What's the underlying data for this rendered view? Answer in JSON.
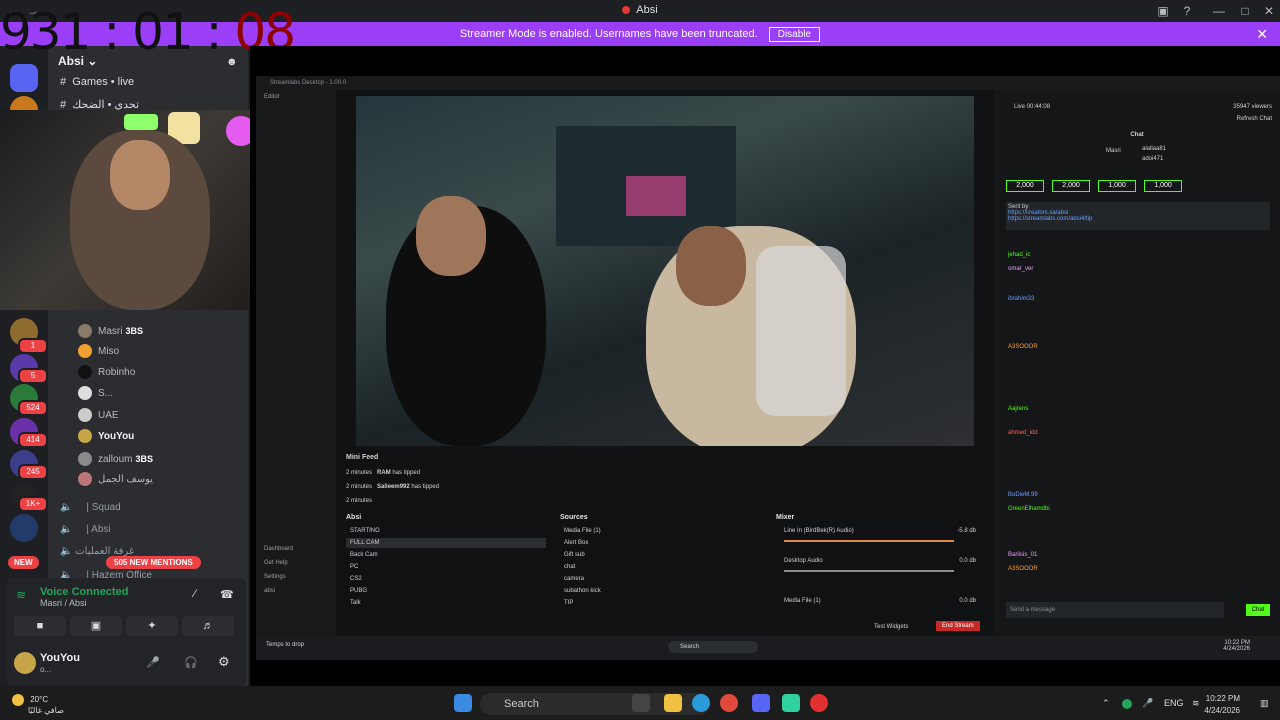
{
  "window": {
    "title": "Absi"
  },
  "banner": {
    "text": "Streamer Mode is enabled. Usernames have been truncated.",
    "button": "Disable"
  },
  "timer": {
    "hours": "931",
    "sep1": ":",
    "minutes": "01",
    "sep2": ":",
    "seconds": "08"
  },
  "rail": {
    "badges": [
      "1",
      "5",
      "524",
      "414",
      "245",
      "1K+"
    ],
    "new_label": "NEW"
  },
  "guild": {
    "name": "Absi"
  },
  "channels": [
    {
      "label": "Games • live"
    },
    {
      "label": "تحدي • الضحك"
    }
  ],
  "members": [
    {
      "name": "Masri",
      "tag": "3BS"
    },
    {
      "name": "Miso",
      "tag": ""
    },
    {
      "name": "Robinho",
      "tag": ""
    },
    {
      "name": "S...",
      "tag": ""
    },
    {
      "name": "UAE",
      "tag": ""
    },
    {
      "name": "YouYou",
      "tag": ""
    },
    {
      "name": "zalloum",
      "tag": "3BS"
    },
    {
      "name": "يوسف الجمل",
      "tag": ""
    }
  ],
  "voice_channels": [
    {
      "label": "| Squad"
    },
    {
      "label": "| Absi"
    },
    {
      "label": "غرفة العمليات"
    },
    {
      "label": "| Hazem Office"
    }
  ],
  "mentions": "505 NEW MENTIONS",
  "voice": {
    "status": "Voice Connected",
    "location": "Masri / Absi"
  },
  "user": {
    "name": "YouYou",
    "status": "o..."
  },
  "streamlabs": {
    "title": "Streamlabs Desktop - 1.00.0",
    "nav": [
      "Editor",
      "Dashboard",
      "Get Help",
      "Settings",
      "absi"
    ],
    "mini_feed_title": "Mini Feed",
    "feed": [
      {
        "time": "2 minutes",
        "user": "RAM",
        "text": "has tipped"
      },
      {
        "time": "2 minutes",
        "user": "Salieem992",
        "text": "has tipped"
      },
      {
        "time": "2 minutes",
        "user": "",
        "text": ""
      }
    ],
    "scenes_title": "Absi",
    "scenes": [
      "STARTING",
      "FULL CAM",
      "Back Cam",
      "PC",
      "CS2",
      "PUBG",
      "Talk"
    ],
    "sources_title": "Sources",
    "sources": [
      "Media File (1)",
      "Alert Box",
      "Gift sub",
      "chat",
      "camera",
      "subathon kick",
      "TIP"
    ],
    "mixer_title": "Mixer",
    "mixer": [
      {
        "name": "Line In (BirdBek(R) Audio)",
        "value": "-5.8 db"
      },
      {
        "name": "Desktop Audio",
        "value": "0.0 db"
      },
      {
        "name": "Media File (1)",
        "value": "0.0 db"
      }
    ],
    "test_widgets": "Test Widgets",
    "end_stream": "End Stream"
  },
  "chat": {
    "live_time": "Live 00:44:08",
    "viewers": "35947 viewers",
    "refresh": "Refresh Chat",
    "title": "Chat",
    "top_user": "Masri",
    "top_names": [
      "alallaa81",
      "adoi471"
    ],
    "gifts": [
      "2,000",
      "2,000",
      "1,000",
      "1,000"
    ],
    "pinned_by": "Sent by",
    "pinned_link": "https://creators.sa/absi",
    "pinned_link2": "https://streamlabs.com/absi4/tip",
    "lines": [
      "jehad_ic",
      "omar_ver",
      "ibrahim33",
      "A3SOOOR",
      "Aajrens",
      "ahmed_idd",
      "BoDieM.99",
      "GreenElhamdbi",
      "Bariisis_01",
      "A3SOOOR"
    ],
    "input_placeholder": "Send a message",
    "send": "Chat"
  },
  "inner_taskbar": {
    "search": "Search",
    "weather": "Temps to drop",
    "time": "10:22 PM",
    "date": "4/24/2026"
  },
  "taskbar": {
    "weather_temp": "20°C",
    "weather_desc": "صافي غالبًا",
    "search": "Search",
    "lang": "ENG",
    "time": "10:22 PM",
    "date": "4/24/2026"
  }
}
